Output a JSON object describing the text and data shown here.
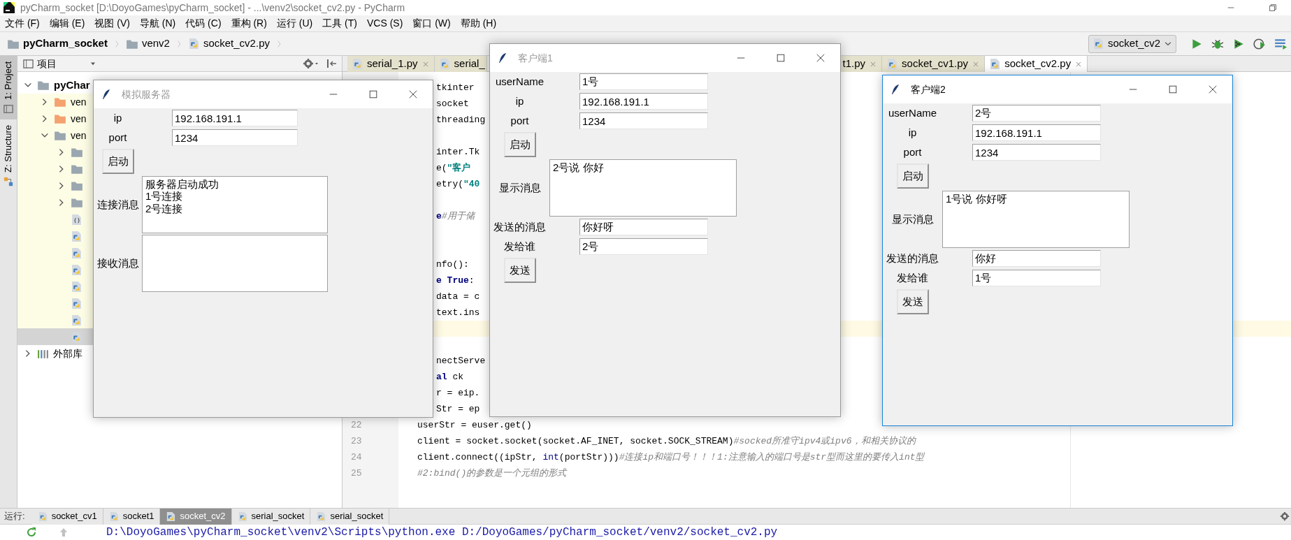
{
  "title_bar": {
    "title": "pyCharm_socket [D:\\DoyoGames\\pyCharm_socket] - ...\\venv2\\socket_cv2.py - PyCharm"
  },
  "menu": [
    "文件 (F)",
    "编辑 (E)",
    "视图 (V)",
    "导航 (N)",
    "代码 (C)",
    "重构 (R)",
    "运行 (U)",
    "工具 (T)",
    "VCS (S)",
    "窗口 (W)",
    "帮助 (H)"
  ],
  "breadcrumb": [
    {
      "label": "pyCharm_socket",
      "kind": "project"
    },
    {
      "label": "venv2",
      "kind": "folder"
    },
    {
      "label": "socket_cv2.py",
      "kind": "python"
    }
  ],
  "run_config": {
    "label": "socket_cv2"
  },
  "side_tabs": [
    {
      "label": "1: Project",
      "selected": true
    },
    {
      "label": "Z: Structure",
      "selected": false
    }
  ],
  "project": {
    "title": "项目",
    "tree": [
      {
        "label": "pyChar",
        "kind": "project",
        "expanded": true,
        "selected": false,
        "children": [
          {
            "label": "ven",
            "kind": "excluded",
            "expanded": false,
            "selected": false
          },
          {
            "label": "ven",
            "kind": "excluded",
            "expanded": false,
            "selected": false
          },
          {
            "label": "ven",
            "kind": "folder",
            "expanded": true,
            "selected": false,
            "children": [
              {
                "kind": "folder",
                "expanded": false,
                "selected": false
              },
              {
                "kind": "folder",
                "expanded": false,
                "selected": false
              },
              {
                "kind": "folder",
                "expanded": false,
                "selected": false
              },
              {
                "kind": "folder",
                "expanded": false,
                "selected": false
              },
              {
                "kind": "json",
                "selected": false
              },
              {
                "kind": "python",
                "selected": false
              },
              {
                "kind": "python",
                "selected": false
              },
              {
                "kind": "python",
                "selected": false
              },
              {
                "kind": "python",
                "selected": false
              },
              {
                "kind": "python",
                "selected": false
              },
              {
                "kind": "python",
                "selected": false
              },
              {
                "kind": "python",
                "selected": true
              }
            ]
          }
        ]
      },
      {
        "label": "外部库",
        "kind": "library",
        "expanded": false,
        "selected": false
      }
    ]
  },
  "editor": {
    "tabs": [
      {
        "label": "serial_1.py",
        "kind": "file",
        "selected": false
      },
      {
        "label": "serial_",
        "kind": "head",
        "selected": false
      },
      {
        "label": "t1.py",
        "kind": "tail",
        "selected": false
      },
      {
        "label": "socket_cv1.py",
        "kind": "file",
        "selected": false
      },
      {
        "label": "socket_cv2.py",
        "kind": "file",
        "selected": true
      }
    ],
    "lines": [
      {
        "kind": "fragment",
        "highlighted": false,
        "segments": [
          {
            "kind": "plain",
            "text": "tkinter"
          }
        ]
      },
      {
        "kind": "fragment",
        "highlighted": false,
        "segments": [
          {
            "kind": "plain",
            "text": "socket"
          }
        ]
      },
      {
        "kind": "fragment",
        "highlighted": false,
        "segments": [
          {
            "kind": "plain",
            "text": "threading"
          }
        ]
      },
      {
        "kind": "blank",
        "highlighted": false
      },
      {
        "kind": "fragment",
        "highlighted": false,
        "segments": [
          {
            "kind": "plain",
            "text": "inter.Tk"
          }
        ]
      },
      {
        "kind": "fragment",
        "highlighted": false,
        "segments": [
          {
            "kind": "plain",
            "text": "e("
          },
          {
            "kind": "string",
            "text": "\"客户"
          }
        ]
      },
      {
        "kind": "fragment",
        "highlighted": false,
        "segments": [
          {
            "kind": "plain",
            "text": "etry("
          },
          {
            "kind": "string",
            "text": "\"40"
          }
        ]
      },
      {
        "kind": "blank",
        "highlighted": false
      },
      {
        "kind": "fragment",
        "highlighted": false,
        "segments": [
          {
            "kind": "keyword",
            "text": "e"
          },
          {
            "kind": "comment",
            "text": "#用于储"
          }
        ]
      },
      {
        "kind": "blank",
        "highlighted": false
      },
      {
        "kind": "blank",
        "highlighted": false
      },
      {
        "kind": "fragment",
        "highlighted": false,
        "segments": [
          {
            "kind": "plain",
            "text": "nfo():"
          }
        ]
      },
      {
        "kind": "fragment",
        "highlighted": false,
        "segments": [
          {
            "kind": "keyword",
            "text": "e True"
          },
          {
            "kind": "plain",
            "text": ":"
          }
        ]
      },
      {
        "kind": "fragment",
        "highlighted": false,
        "segments": [
          {
            "kind": "plain",
            "text": "data = c"
          }
        ]
      },
      {
        "kind": "fragment",
        "highlighted": false,
        "segments": [
          {
            "kind": "plain",
            "text": "text.ins"
          }
        ]
      },
      {
        "kind": "blank",
        "highlighted": true
      },
      {
        "kind": "blank",
        "highlighted": false
      },
      {
        "kind": "fragment",
        "highlighted": false,
        "segments": [
          {
            "kind": "plain",
            "text": "nectServe"
          }
        ]
      },
      {
        "kind": "fragment",
        "highlighted": false,
        "segments": [
          {
            "kind": "keyword",
            "text": "al"
          },
          {
            "kind": "plain",
            "text": " ck"
          }
        ]
      },
      {
        "kind": "fragment",
        "highlighted": false,
        "segments": [
          {
            "kind": "plain",
            "text": "r = eip."
          }
        ]
      },
      {
        "kind": "fragment",
        "highlighted": false,
        "segments": [
          {
            "kind": "plain",
            "text": "Str = ep"
          }
        ]
      },
      {
        "kind": "full",
        "number": "22",
        "highlighted": false,
        "segments": [
          {
            "kind": "plain",
            "text": "userStr = euser.get()"
          }
        ]
      },
      {
        "kind": "full",
        "number": "23",
        "highlighted": false,
        "segments": [
          {
            "kind": "plain",
            "text": "client = socket.socket(socket.AF_INET, socket.SOCK_STREAM)"
          },
          {
            "kind": "comment",
            "text": "#socked所准守ipv4或ipv6，和相关协议的"
          }
        ]
      },
      {
        "kind": "full",
        "number": "24",
        "highlighted": false,
        "segments": [
          {
            "kind": "plain",
            "text": "client.connect((ipStr, "
          },
          {
            "kind": "builtin",
            "text": "int"
          },
          {
            "kind": "plain",
            "text": "(portStr)))"
          },
          {
            "kind": "comment",
            "text": "#连接ip和端口号！！！1:注意输入的端口号是str型而这里的要传入int型"
          }
        ]
      },
      {
        "kind": "full",
        "number": "25",
        "highlighted": false,
        "segments": [
          {
            "kind": "comment",
            "text": "#2:bind()的参数是一个元组的形式"
          }
        ]
      }
    ]
  },
  "windows": [
    {
      "kind": "server",
      "title": "模拟服务器",
      "active": false,
      "rows": [
        {
          "kind": "entry",
          "label": "ip",
          "value": "192.168.191.1"
        },
        {
          "kind": "entry",
          "label": "port",
          "value": "1234"
        },
        {
          "kind": "button",
          "label": "启动"
        },
        {
          "kind": "text",
          "label": "连接消息",
          "text": "服务器启动成功\n1号连接\n2号连接"
        },
        {
          "kind": "text",
          "label": "接收消息"
        }
      ]
    },
    {
      "kind": "client",
      "title": "客户端1",
      "active": false,
      "rows": [
        {
          "kind": "entry",
          "label": "userName",
          "value": "1号"
        },
        {
          "kind": "entry",
          "label": "ip",
          "value": "192.168.191.1"
        },
        {
          "kind": "entry",
          "label": "port",
          "value": "1234"
        },
        {
          "kind": "button",
          "label": "启动"
        },
        {
          "kind": "text",
          "label": "显示消息",
          "text": "2号说 你好"
        },
        {
          "kind": "entry",
          "label": "发送的消息",
          "value": "你好呀"
        },
        {
          "kind": "entry",
          "label": "发给谁",
          "value": "2号"
        },
        {
          "kind": "button",
          "label": "发送"
        }
      ]
    },
    {
      "kind": "client",
      "title": "客户端2",
      "active": true,
      "rows": [
        {
          "kind": "entry",
          "label": "userName",
          "value": "2号"
        },
        {
          "kind": "entry",
          "label": "ip",
          "value": "192.168.191.1"
        },
        {
          "kind": "entry",
          "label": "port",
          "value": "1234"
        },
        {
          "kind": "button",
          "label": "启动"
        },
        {
          "kind": "text",
          "label": "显示消息",
          "text": "1号说 你好呀"
        },
        {
          "kind": "entry",
          "label": "发送的消息",
          "value": "你好"
        },
        {
          "kind": "entry",
          "label": "发给谁",
          "value": "1号"
        },
        {
          "kind": "button",
          "label": "发送"
        }
      ]
    }
  ],
  "run_panel": {
    "label": "运行:",
    "tabs": [
      {
        "label": "socket_cv1",
        "selected": false
      },
      {
        "label": "socket1",
        "selected": false
      },
      {
        "label": "socket_cv2",
        "selected": true
      },
      {
        "label": "serial_socket",
        "selected": false
      },
      {
        "label": "serial_socket",
        "selected": false
      }
    ],
    "console": "D:\\DoyoGames\\pyCharm_socket\\venv2\\Scripts\\python.exe D:/DoyoGames/pyCharm_socket/venv2/socket_cv2.py"
  }
}
